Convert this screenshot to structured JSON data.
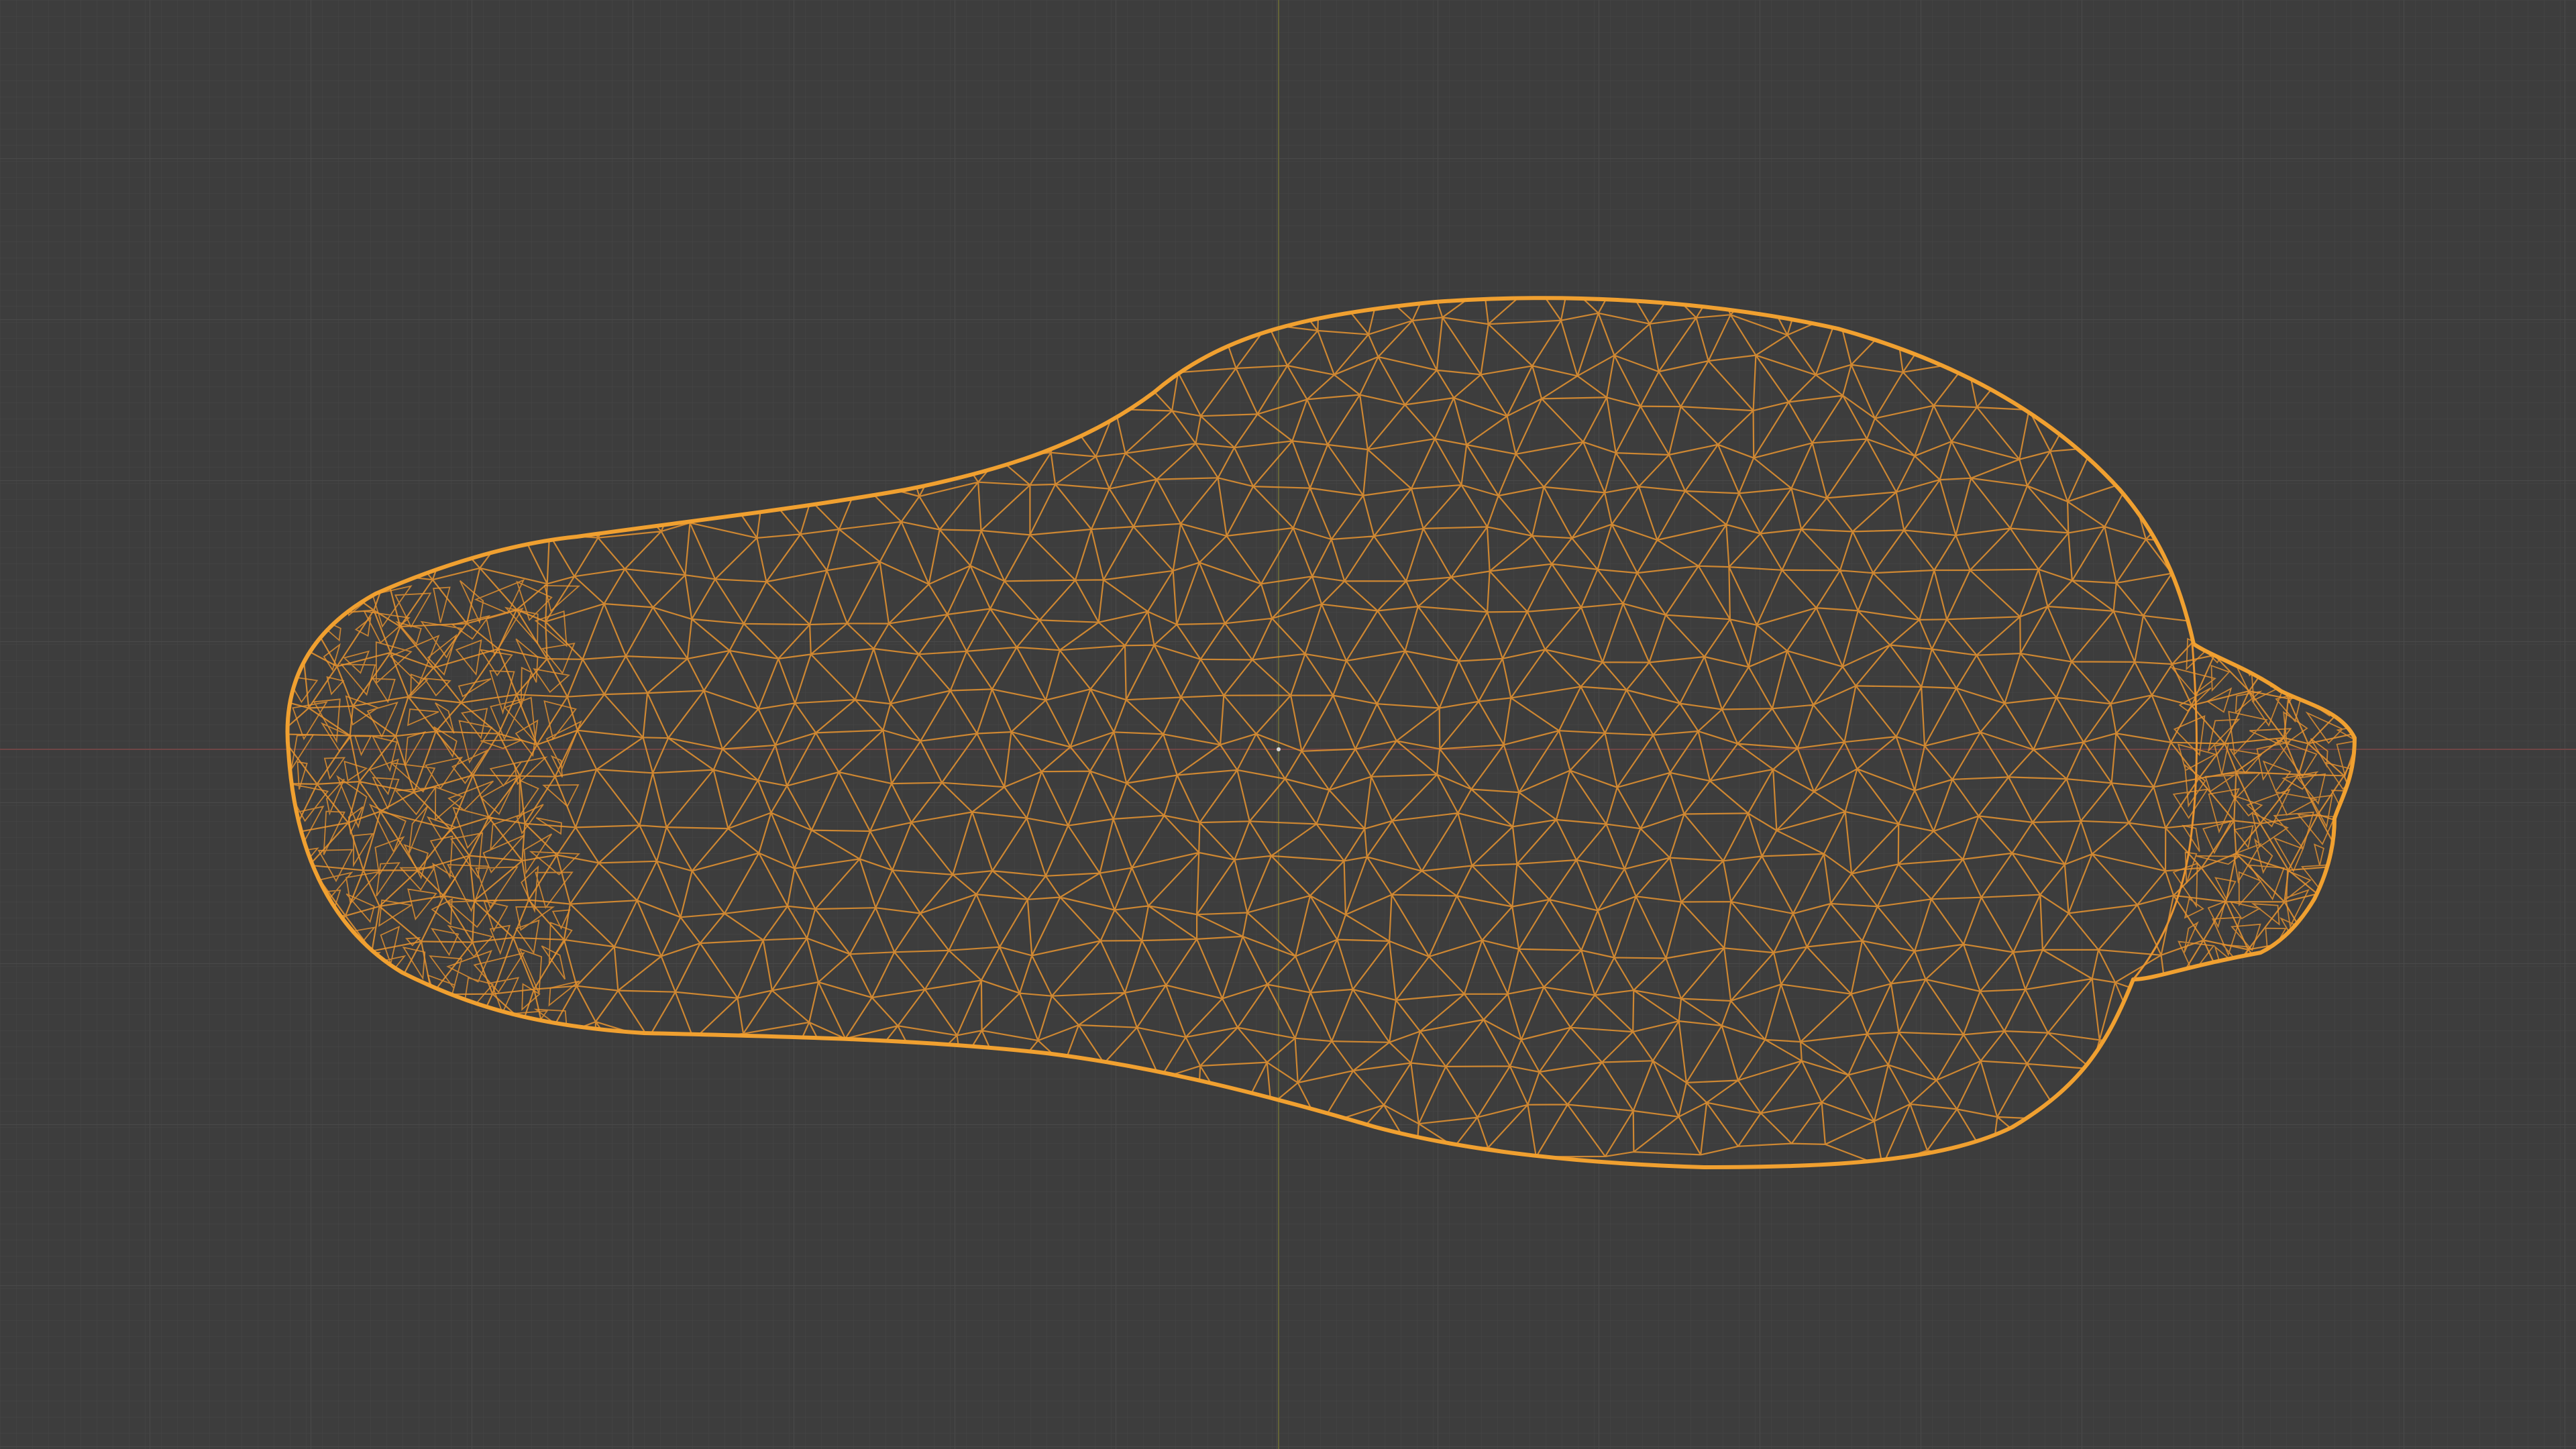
{
  "viewport": {
    "background_color": "#3d3d3d",
    "grid_color": "#454545",
    "grid_major_color": "#4a4a4a",
    "x_axis_color": "#7a4a4a",
    "y_axis_color": "#6b6a3c",
    "shading_mode": "wireframe"
  },
  "object": {
    "selected": true,
    "outline_color": "#f0a030",
    "wire_color": "#e89430",
    "shape": "gourd"
  },
  "origin_marker": {
    "color": "#d8d8d8"
  }
}
